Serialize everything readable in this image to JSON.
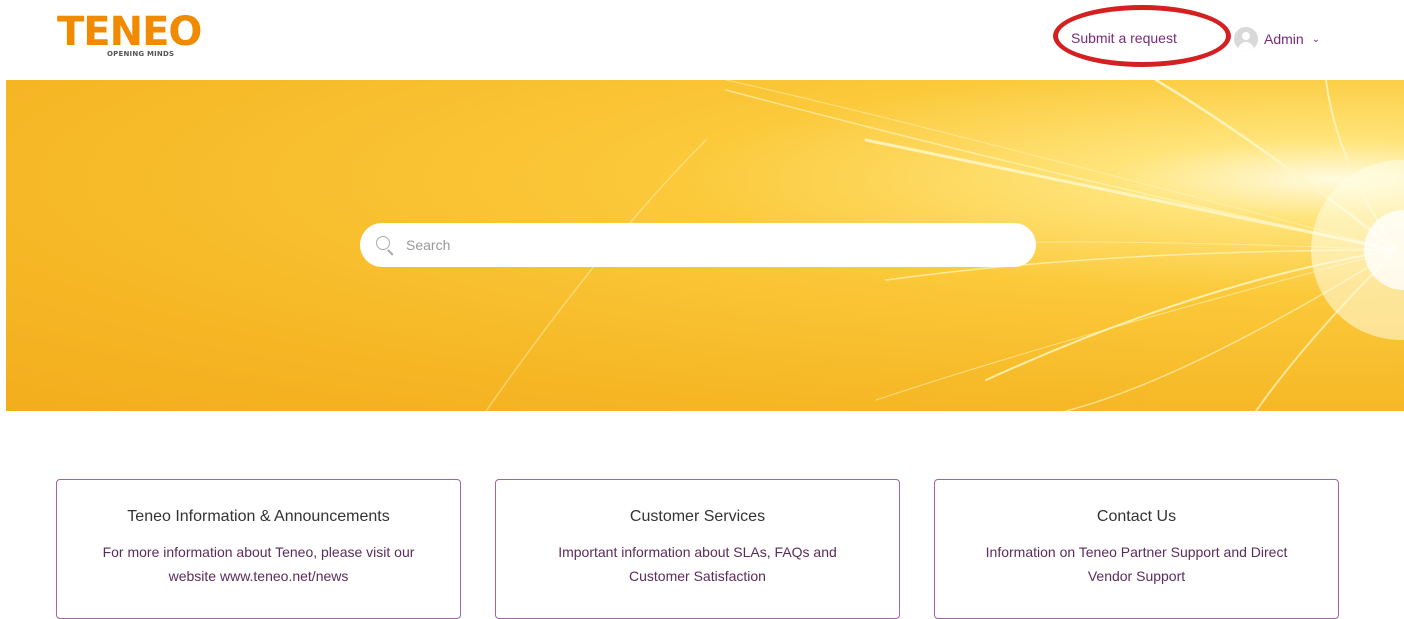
{
  "header": {
    "logo": {
      "word": "TENEO",
      "tagline": "OPENING MINDS"
    },
    "submit_request": "Submit a request",
    "user_name": "Admin",
    "user_chevron": "⌄"
  },
  "hero": {
    "search_placeholder": "Search"
  },
  "cards": [
    {
      "title": "Teneo Information & Announcements",
      "description": "For more information about Teneo, please visit our website www.teneo.net/news"
    },
    {
      "title": "Customer Services",
      "description": "Important information about SLAs, FAQs and Customer Satisfaction"
    },
    {
      "title": "Contact Us",
      "description": "Information on Teneo Partner Support and Direct Vendor Support"
    }
  ],
  "colors": {
    "brand_orange": "#f08a00",
    "link_purple": "#7a2a7a",
    "card_border": "#a463a4",
    "hero_yellow": "#f6b826",
    "annotation_red": "#d42020"
  }
}
